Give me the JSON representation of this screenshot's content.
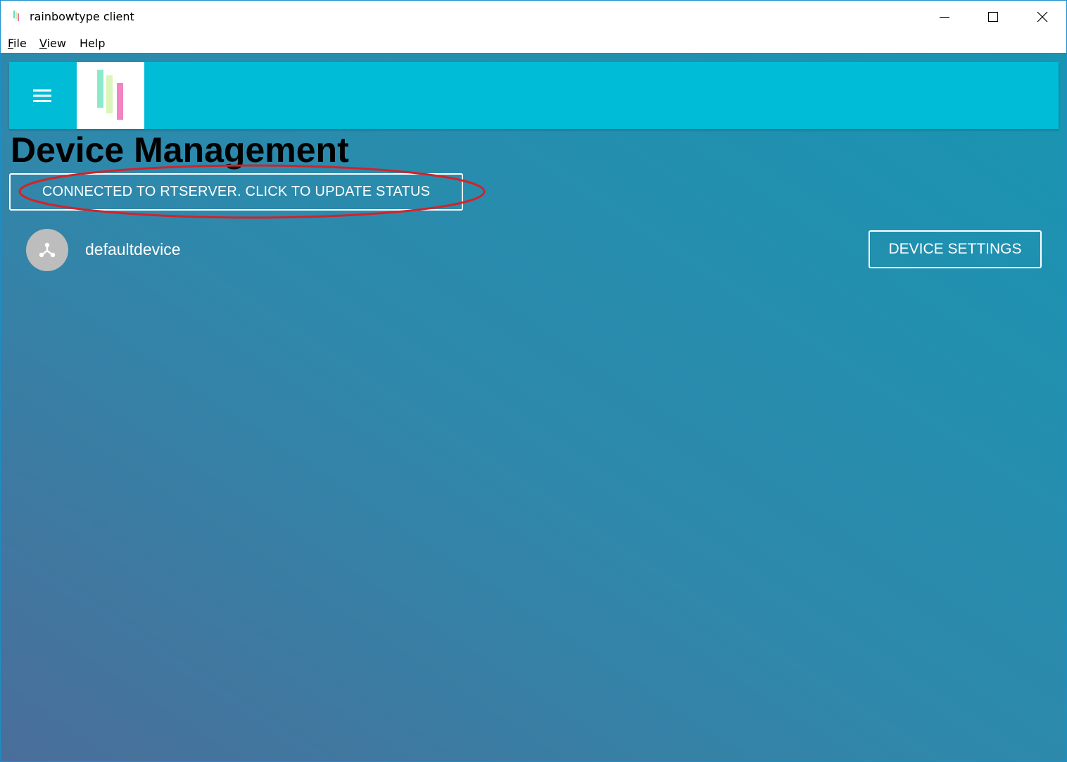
{
  "window": {
    "title": "rainbowtype client",
    "controls": {
      "minimize": "minimize-icon",
      "maximize": "maximize-icon",
      "close": "close-icon"
    }
  },
  "menubar": {
    "items": [
      {
        "mnemonic": "F",
        "rest": "ile"
      },
      {
        "mnemonic": "V",
        "rest": "iew"
      },
      {
        "mnemonic": "",
        "rest": "Help"
      }
    ]
  },
  "appbar": {
    "menu_icon": "menu-icon",
    "logo": "rainbowtype-logo",
    "color": "#01bcd6"
  },
  "page": {
    "title": "Device Management",
    "status_button": "CONNECTED TO RTSERVER. CLICK TO UPDATE STATUS",
    "annotation_color": "#d2232a"
  },
  "devices": [
    {
      "name": "defaultdevice",
      "icon": "device-hub-icon",
      "settings_button": "DEVICE SETTINGS"
    }
  ]
}
